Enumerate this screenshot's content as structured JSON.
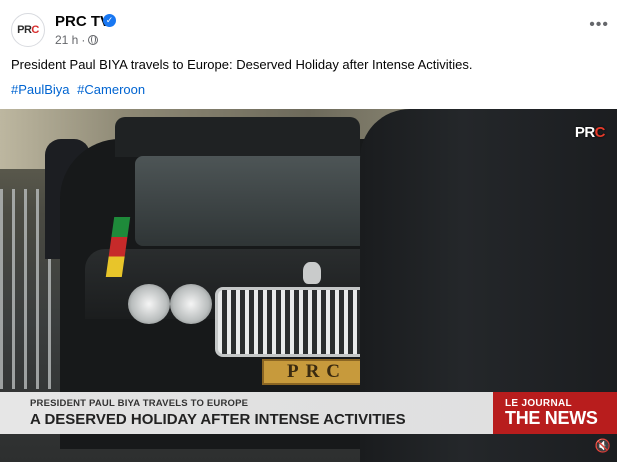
{
  "post": {
    "page_name": "PRC TV",
    "time": "21 h",
    "time_separator": "·",
    "caption": "President Paul BIYA travels to Europe: Deserved Holiday after Intense Activities.",
    "hashtags": [
      "#PaulBiya",
      "#Cameroon"
    ],
    "more_label": "•••",
    "verified_glyph": "✓",
    "avatar_logo": {
      "main": "PR",
      "accent": "C"
    }
  },
  "video": {
    "channel_logo": {
      "main": "PR",
      "accent": "C"
    },
    "plate_text": "PRC",
    "lower_third": {
      "line1": "PRESIDENT PAUL BIYA TRAVELS TO EUROPE",
      "line2": "A DESERVED HOLIDAY AFTER INTENSE ACTIVITIES",
      "program_small": "LE JOURNAL",
      "program_big": "THE NEWS"
    },
    "mute_glyph": "🔇"
  },
  "colors": {
    "link": "#0064d1",
    "verified": "#1877f2",
    "news_red": "#b81d1d"
  },
  "icons": [
    "verified-badge-icon",
    "globe-icon",
    "more-options-icon",
    "mute-icon"
  ]
}
